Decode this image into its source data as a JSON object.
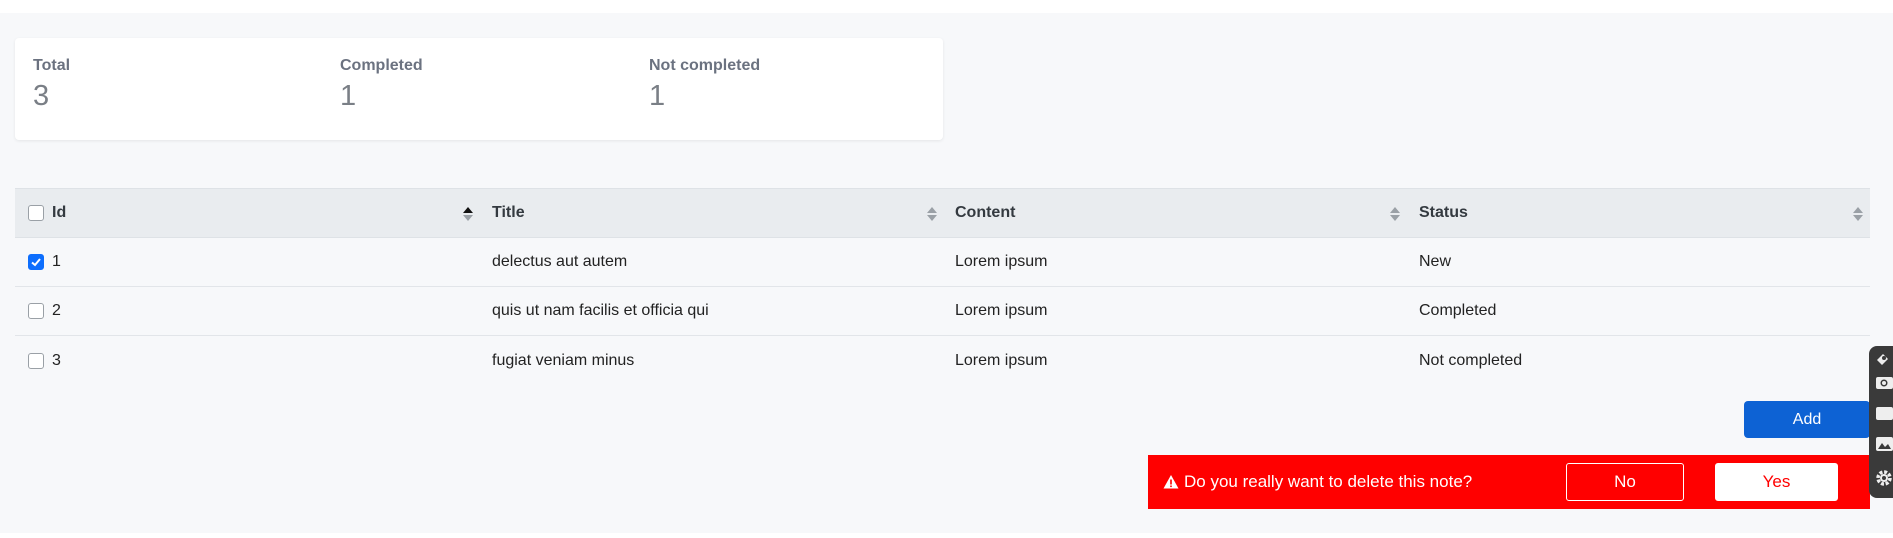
{
  "stats": [
    {
      "label": "Total",
      "value": "3"
    },
    {
      "label": "Completed",
      "value": "1"
    },
    {
      "label": "Not completed",
      "value": "1"
    }
  ],
  "table": {
    "headers": {
      "id": "Id",
      "title": "Title",
      "content": "Content",
      "status": "Status"
    },
    "rows": [
      {
        "id": "1",
        "title": "delectus aut autem",
        "content": "Lorem ipsum",
        "status": "New",
        "checked": true
      },
      {
        "id": "2",
        "title": "quis ut nam facilis et officia qui",
        "content": "Lorem ipsum",
        "status": "Completed",
        "checked": false
      },
      {
        "id": "3",
        "title": "fugiat veniam minus",
        "content": "Lorem ipsum",
        "status": "Not completed",
        "checked": false
      }
    ]
  },
  "actions": {
    "add_label": "Add"
  },
  "confirm": {
    "message": "Do you really want to delete this note?",
    "no_label": "No",
    "yes_label": "Yes"
  },
  "colors": {
    "accent": "#0d62d4",
    "danger": "#ff0000",
    "checkbox": "#0d6efd"
  },
  "toolbar_icons": [
    "pin-icon",
    "camera-icon",
    "window-icon",
    "image-icon",
    "gear-icon"
  ]
}
